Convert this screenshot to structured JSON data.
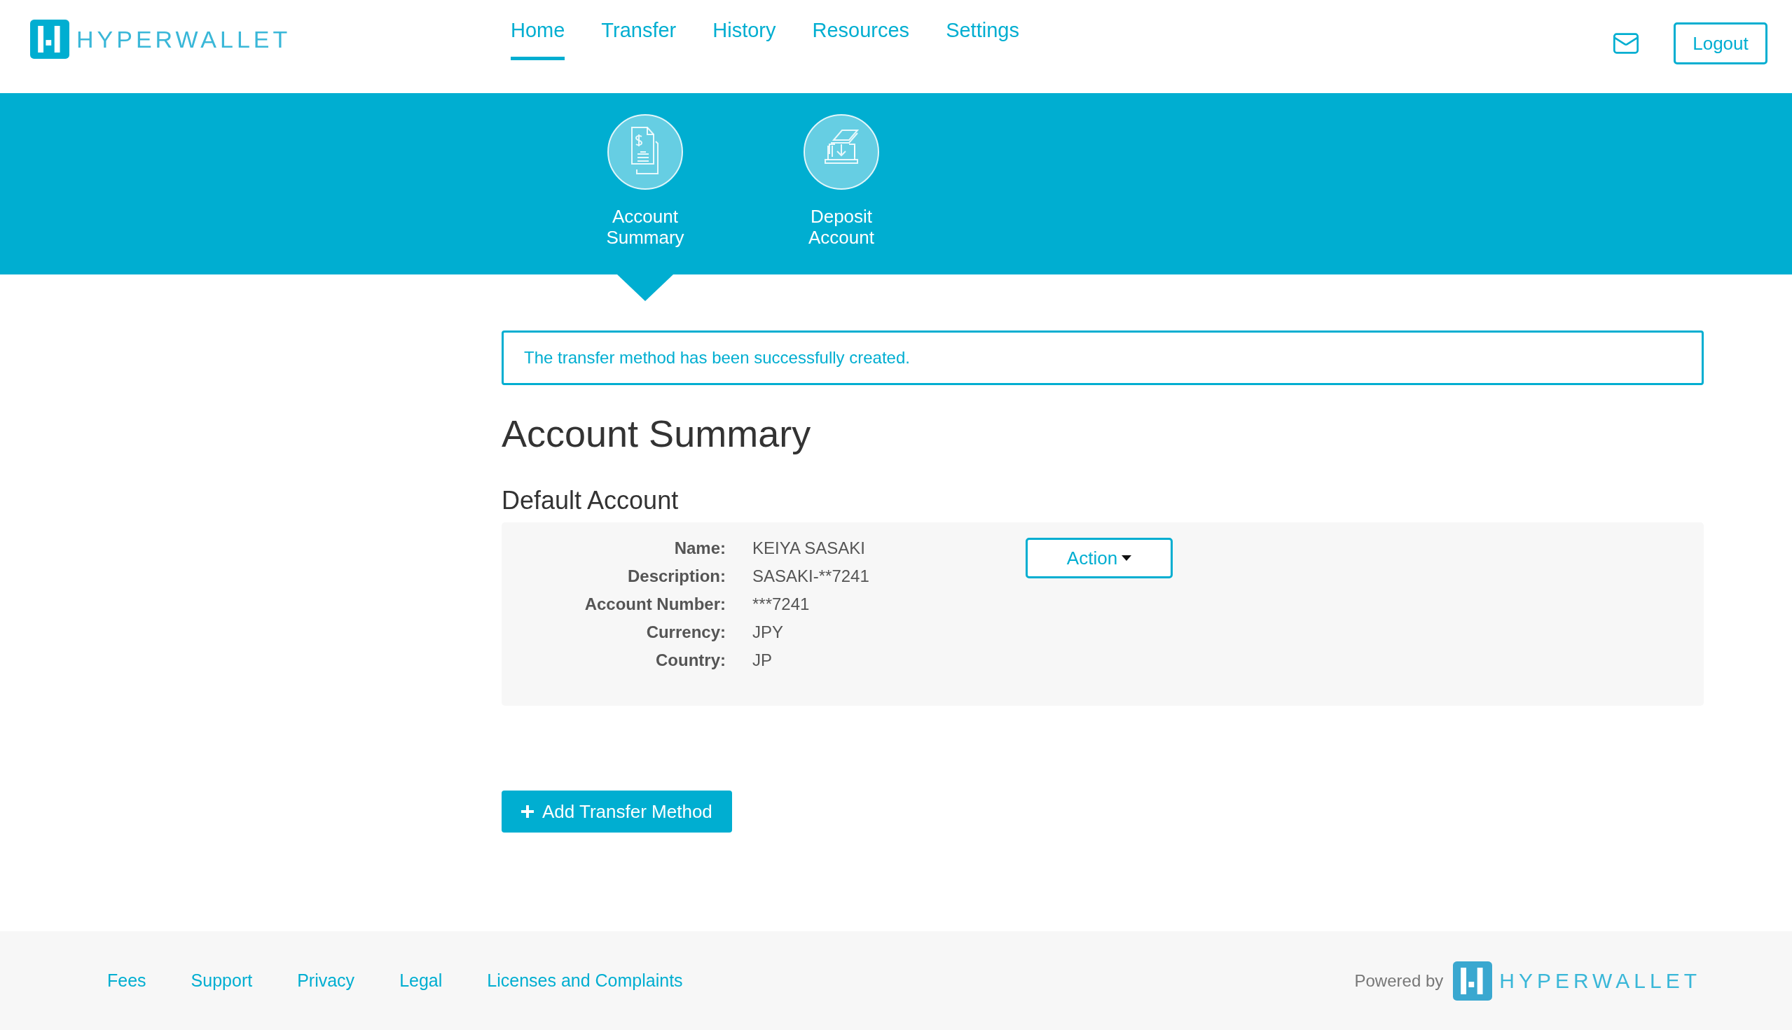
{
  "header": {
    "logo": "HYPERWALLET",
    "nav": [
      {
        "label": "Home",
        "selected": true
      },
      {
        "label": "Transfer",
        "selected": false
      },
      {
        "label": "History",
        "selected": false
      },
      {
        "label": "Resources",
        "selected": false
      },
      {
        "label": "Settings",
        "selected": false
      }
    ],
    "logout": "Logout"
  },
  "subnav": [
    {
      "kind": "summary",
      "label": "Account Summary",
      "selected": true
    },
    {
      "kind": "deposit",
      "label": "Deposit Account",
      "selected": false
    }
  ],
  "alert": "The transfer method has been successfully created.",
  "title": "Account Summary",
  "section": "Default Account",
  "account": {
    "fields": [
      {
        "label": "Name:",
        "value": "KEIYA SASAKI"
      },
      {
        "label": "Description:",
        "value": "SASAKI-**7241"
      },
      {
        "label": "Account Number:",
        "value": "***7241"
      },
      {
        "label": "Currency:",
        "value": "JPY"
      },
      {
        "label": "Country:",
        "value": "JP"
      }
    ],
    "action": "Action"
  },
  "add_button": "Add Transfer Method",
  "footer": {
    "links": [
      "Fees",
      "Support",
      "Privacy",
      "Legal",
      "Licenses and Complaints"
    ],
    "powered_by": "Powered by",
    "logo": "HYPERWALLET"
  }
}
